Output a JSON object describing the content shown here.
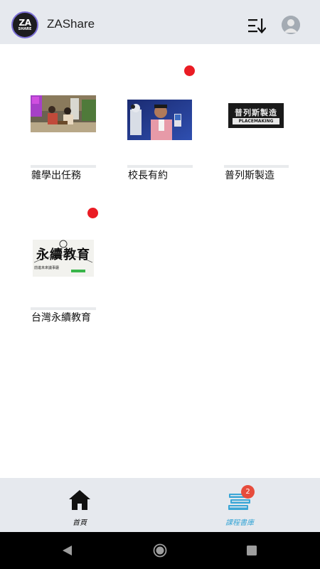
{
  "app": {
    "title": "ZAShare",
    "logo_text": "ZA",
    "logo_subtext": "SHARE"
  },
  "courses": [
    {
      "title": "雜學出任務",
      "unread": false
    },
    {
      "title": "校長有約",
      "unread": true
    },
    {
      "title": "普列斯製造",
      "unread": false,
      "thumb_text": "普列斯製造",
      "thumb_subtext": "PLACEMAKING"
    },
    {
      "title": "台灣永續教育",
      "unread": true,
      "thumb_text": "永續教育",
      "thumb_subtext": "前進未來議事廳"
    }
  ],
  "bottom_nav": {
    "home_label": "首頁",
    "library_label": "課程書庫",
    "library_badge": "2"
  },
  "colors": {
    "appbar_bg": "#e6e9ee",
    "unread_dot": "#ea1c24",
    "library_accent": "#3aa6d6",
    "badge": "#e74c3c"
  },
  "icons": [
    "sort-icon",
    "avatar-icon",
    "home-icon",
    "books-icon",
    "back-icon",
    "home-circle-icon",
    "recents-icon"
  ]
}
